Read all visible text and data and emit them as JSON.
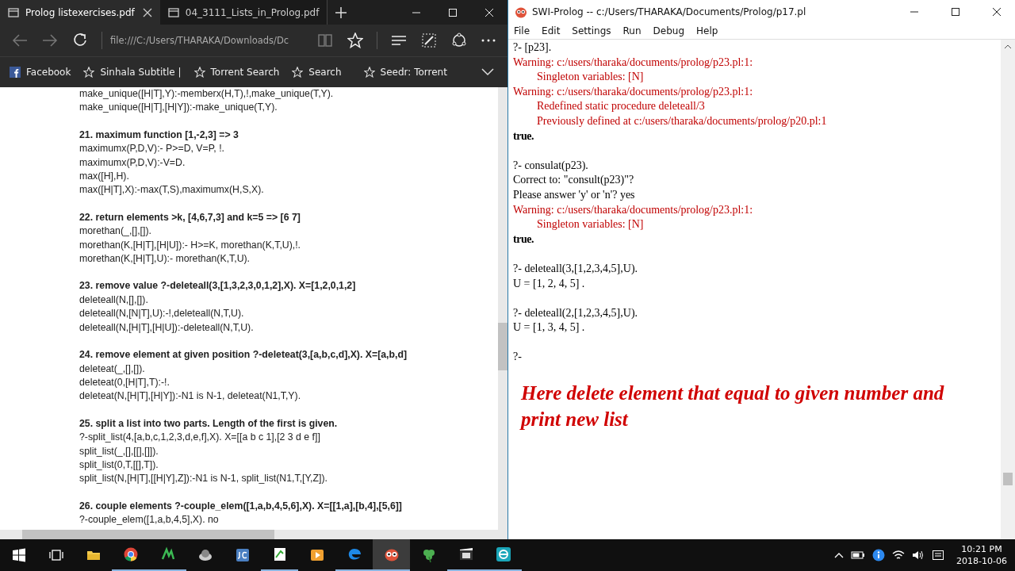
{
  "browser": {
    "tabs": [
      {
        "title": "Prolog listexercises.pdf",
        "selected": true
      },
      {
        "title": "04_3111_Lists_in_Prolog.pdf",
        "selected": false
      }
    ],
    "address": "file:///C:/Users/THARAKA/Downloads/Dc",
    "favorites": [
      {
        "label": "Facebook",
        "kind": "facebook"
      },
      {
        "label": "Sinhala Subtitle |",
        "kind": "star"
      },
      {
        "label": "Torrent Search",
        "kind": "star"
      },
      {
        "label": "Search",
        "kind": "star"
      },
      {
        "label": "Seedr: Torrent",
        "kind": "star"
      }
    ],
    "pdf_blocks": [
      [
        {
          "text": "make_unique([H|T],Y):-memberx(H,T),!,make_unique(T,Y).",
          "bold": false
        },
        {
          "text": "make_unique([H|T],[H|Y]):-make_unique(T,Y).",
          "bold": false
        }
      ],
      [
        {
          "text": "21. maximum function [1,-2,3] => 3",
          "bold": true
        },
        {
          "text": "maximumx(P,D,V):- P>=D, V=P, !.",
          "bold": false
        },
        {
          "text": "maximumx(P,D,V):-V=D.",
          "bold": false
        },
        {
          "text": "max([H],H).",
          "bold": false
        },
        {
          "text": "max([H|T],X):-max(T,S),maximumx(H,S,X).",
          "bold": false
        }
      ],
      [
        {
          "text": "22. return elements >k, [4,6,7,3] and k=5 => [6 7]",
          "bold": true
        },
        {
          "text": "morethan(_,[],[]).",
          "bold": false
        },
        {
          "text": "morethan(K,[H|T],[H|U]):- H>=K, morethan(K,T,U),!.",
          "bold": false
        },
        {
          "text": "morethan(K,[H|T],U):- morethan(K,T,U).",
          "bold": false
        }
      ],
      [
        {
          "text": "23. remove value ?-deleteall(3,[1,3,2,3,0,1,2],X). X=[1,2,0,1,2]",
          "bold": true
        },
        {
          "text": "deleteall(N,[],[]).",
          "bold": false
        },
        {
          "text": "deleteall(N,[N|T],U):-!,deleteall(N,T,U).",
          "bold": false
        },
        {
          "text": "deleteall(N,[H|T],[H|U]):-deleteall(N,T,U).",
          "bold": false
        }
      ],
      [
        {
          "text": "24. remove element at given position ?-deleteat(3,[a,b,c,d],X). X=[a,b,d]",
          "bold": true
        },
        {
          "text": "deleteat(_,[],[]).",
          "bold": false
        },
        {
          "text": "deleteat(0,[H|T],T):-!.",
          "bold": false
        },
        {
          "text": "deleteat(N,[H|T],[H|Y]):-N1 is N-1, deleteat(N1,T,Y).",
          "bold": false
        }
      ],
      [
        {
          "text": "25. split a list into two parts. Length of the first is given.",
          "bold": true
        },
        {
          "text": "?-split_list(4,[a,b,c,1,2,3,d,e,f],X). X=[[a b c 1],[2 3 d e f]]",
          "bold": false
        },
        {
          "text": "split_list(_,[],[[],[]]).",
          "bold": false
        },
        {
          "text": "split_list(0,T,[[],T]).",
          "bold": false
        },
        {
          "text": "split_list(N,[H|T],[[H|Y],Z]):-N1 is N-1, split_list(N1,T,[Y,Z]).",
          "bold": false
        }
      ],
      [
        {
          "text": "26. couple elements ?-couple_elem([1,a,b,4,5,6],X). X=[[1,a],[b,4],[5,6]]",
          "bold": true
        },
        {
          "text": "?-couple_elem([1,a,b,4,5],X). no",
          "bold": false
        }
      ]
    ]
  },
  "prolog": {
    "title": "SWI-Prolog -- c:/Users/THARAKA/Documents/Prolog/p17.pl",
    "menu": [
      "File",
      "Edit",
      "Settings",
      "Run",
      "Debug",
      "Help"
    ],
    "console_blocks": [
      [
        {
          "text": "?- [p23].",
          "kind": "plain"
        },
        {
          "text": "Warning: c:/users/tharaka/documents/prolog/p23.pl:1:",
          "kind": "warning"
        },
        {
          "text": "Singleton variables: [N]",
          "kind": "detail"
        },
        {
          "text": "Warning: c:/users/tharaka/documents/prolog/p23.pl:1:",
          "kind": "warning"
        },
        {
          "text": "Redefined static procedure deleteall/3",
          "kind": "detail"
        },
        {
          "text": "Previously defined at c:/users/tharaka/documents/prolog/p20.pl:1",
          "kind": "detail"
        },
        {
          "text": "true.",
          "kind": "result"
        }
      ],
      [
        {
          "text": "?- consulat(p23).",
          "kind": "plain"
        },
        {
          "text": "Correct to: \"consult(p23)\"?",
          "kind": "plain"
        },
        {
          "text": "Please answer 'y' or 'n'? yes",
          "kind": "plain"
        },
        {
          "text": "Warning: c:/users/tharaka/documents/prolog/p23.pl:1:",
          "kind": "warning"
        },
        {
          "text": "Singleton variables: [N]",
          "kind": "detail"
        },
        {
          "text": "true.",
          "kind": "result"
        }
      ],
      [
        {
          "text": "?- deleteall(3,[1,2,3,4,5],U).",
          "kind": "plain"
        },
        {
          "text": "U = [1, 2, 4, 5] .",
          "kind": "plain"
        }
      ],
      [
        {
          "text": "?- deleteall(2,[1,2,3,4,5],U).",
          "kind": "plain"
        },
        {
          "text": "U = [1, 3, 4, 5] .",
          "kind": "plain"
        }
      ],
      [
        {
          "text": "?-",
          "kind": "plain"
        }
      ]
    ],
    "note": "Here delete element that equal to given number and print new list"
  },
  "taskbar": {
    "apps": [
      {
        "kind": "start",
        "running": false
      },
      {
        "kind": "taskview",
        "running": false
      },
      {
        "kind": "folder",
        "running": false
      },
      {
        "kind": "chrome",
        "running": true
      },
      {
        "kind": "green",
        "running": true
      },
      {
        "kind": "disc",
        "running": false
      },
      {
        "kind": "jc",
        "running": false
      },
      {
        "kind": "notepad",
        "running": true
      },
      {
        "kind": "player",
        "running": false
      },
      {
        "kind": "edge",
        "running": true
      },
      {
        "kind": "owl",
        "running": true
      },
      {
        "kind": "clover",
        "running": false
      },
      {
        "kind": "film",
        "running": true
      },
      {
        "kind": "eset",
        "running": true
      }
    ],
    "time": "10:21 PM",
    "date": "2018-10-06"
  }
}
